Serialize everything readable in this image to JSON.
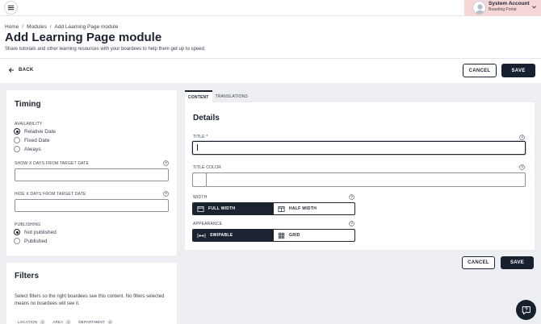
{
  "header": {
    "account_name": "System Account",
    "account_sub": "Boarding Portal",
    "breadcrumb": [
      "Home",
      "Modules",
      "Add Learning Page module"
    ],
    "title": "Add Learning Page module",
    "description": "Share tutorials and other learning resources with your boardees to help them get up to speed."
  },
  "toolbar": {
    "back_label": "BACK",
    "cancel_label": "CANCEL",
    "save_label": "SAVE"
  },
  "timing": {
    "title": "Timing",
    "availability_label": "AVAILABILITY",
    "availability_options": [
      "Relative Date",
      "Fixed Date",
      "Always"
    ],
    "availability_selected": "Relative Date",
    "show_days_label": "SHOW X DAYS FROM TARGET DATE",
    "show_days_value": "",
    "hide_days_label": "HIDE X DAYS FROM TARGET DATE",
    "hide_days_value": "",
    "publishing_label": "PUBLISHING",
    "publishing_options": [
      "Not published",
      "Published"
    ],
    "publishing_selected": "Not published"
  },
  "filters": {
    "title": "Filters",
    "description": "Select filters so the right boardees see this content. No filters selected means no boardees will see it.",
    "chips": [
      {
        "label": "LOCATION",
        "count": "0"
      },
      {
        "label": "AREA",
        "count": "0"
      },
      {
        "label": "DEPARTMENT",
        "count": "0"
      }
    ]
  },
  "tabs": [
    "CONTENT",
    "TRANSLATIONS"
  ],
  "active_tab": "CONTENT",
  "details": {
    "title": "Details",
    "title_field_label": "TITLE *",
    "title_field_value": "",
    "title_color_label": "TITLE COLOR",
    "title_color_value": "",
    "width_label": "WIDTH",
    "width_options": [
      "FULL WIDTH",
      "HALF WIDTH"
    ],
    "width_selected": "FULL WIDTH",
    "appearance_label": "APPEARANCE",
    "appearance_options": [
      "SWIPABLE",
      "GRID"
    ],
    "appearance_selected": "SWIPABLE",
    "cancel_label": "CANCEL",
    "save_label": "SAVE"
  },
  "colors": {
    "primary": "#16202f",
    "account_bg": "#f7d6d8",
    "page_bg": "#eceef1"
  }
}
